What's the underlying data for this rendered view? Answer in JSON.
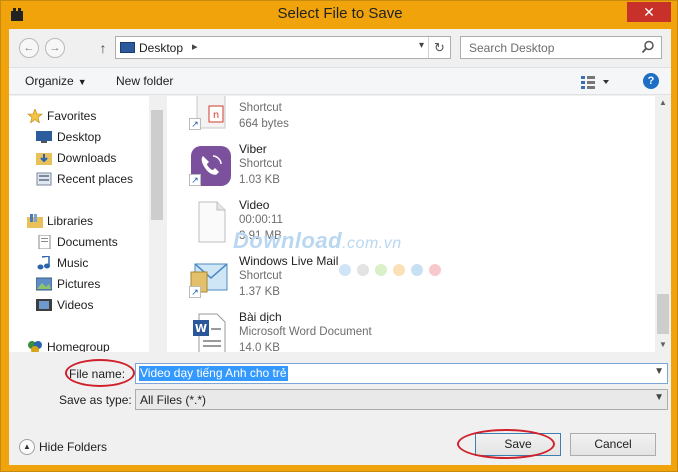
{
  "window": {
    "title": "Select File to Save",
    "close_label": "✕"
  },
  "address_bar": {
    "location": "Desktop",
    "separator": "▸",
    "dropdown": "▾",
    "refresh": "↻"
  },
  "search": {
    "placeholder": "Search Desktop"
  },
  "toolbar": {
    "organize_label": "Organize",
    "new_folder_label": "New folder",
    "help_label": "?"
  },
  "nav_pane": {
    "favorites": [
      "Favorites",
      "Desktop",
      "Downloads",
      "Recent places"
    ],
    "libraries": [
      "Libraries",
      "Documents",
      "Music",
      "Pictures",
      "Videos"
    ],
    "homegroup": "Homegroup"
  },
  "files": [
    {
      "name": "",
      "type": "Shortcut",
      "size": "664 bytes"
    },
    {
      "name": "Viber",
      "type": "Shortcut",
      "size": "1.03 KB"
    },
    {
      "name": "Video",
      "type": "00:00:11",
      "size": "3.91 MB"
    },
    {
      "name": "Windows Live Mail",
      "type": "Shortcut",
      "size": "1.37 KB"
    },
    {
      "name": "Bài dịch",
      "type": "Microsoft Word Document",
      "size": "14.0 KB"
    }
  ],
  "watermark": {
    "main": "Download",
    "tld": ".com.vn"
  },
  "form": {
    "file_name_label": "File name:",
    "file_name_value": "Video dạy tiếng Anh cho trẻ",
    "save_as_type_label": "Save as type:",
    "save_as_type_value": "All Files (*.*)"
  },
  "footer": {
    "hide_folders_label": "Hide Folders",
    "save_label": "Save",
    "cancel_label": "Cancel"
  },
  "colors": {
    "frame": "#f0a30a",
    "close": "#c7312a",
    "selection": "#3399ff",
    "annotation": "#d0202a"
  }
}
